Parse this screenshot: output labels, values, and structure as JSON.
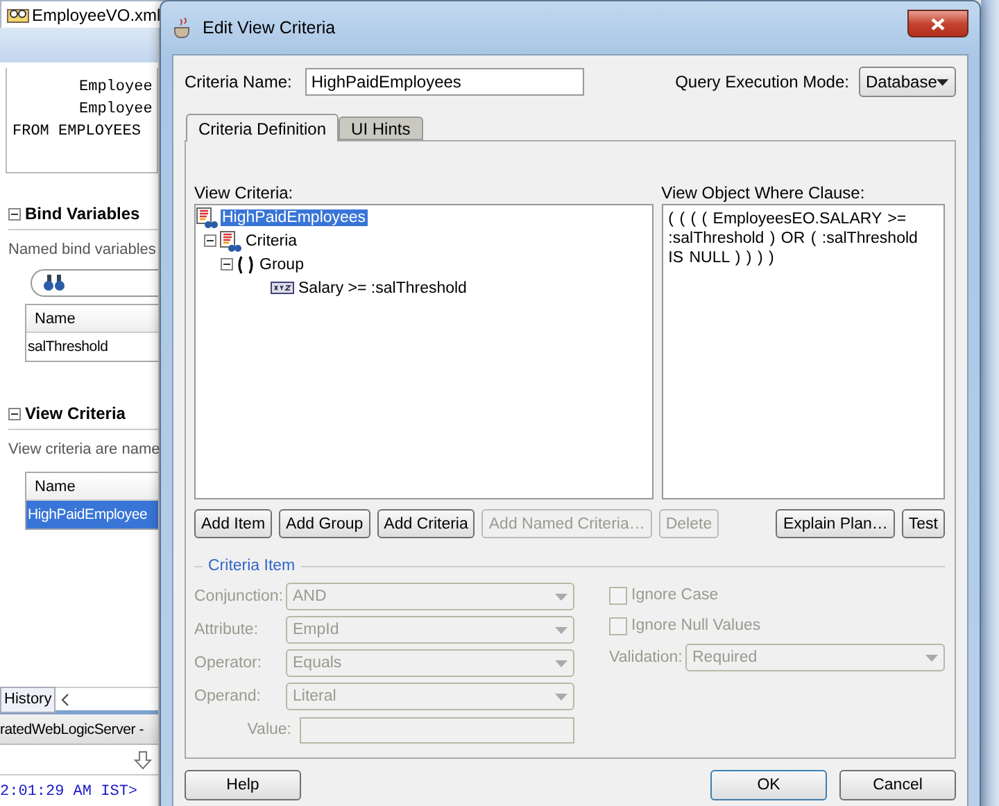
{
  "ide": {
    "editor_tab": "EmployeeVO.xml",
    "code_lines": [
      "Employee",
      "Employee",
      "FROM EMPLOYEES"
    ],
    "bind_variables": {
      "title": "Bind Variables",
      "expanded": true,
      "description": "Named bind variables",
      "columns": [
        "Name"
      ],
      "rows": [
        {
          "name": "salThreshold",
          "selected": false
        }
      ]
    },
    "view_criteria": {
      "title": "View Criteria",
      "expanded": true,
      "description": "View criteria are name",
      "columns": [
        "Name"
      ],
      "rows": [
        {
          "name": "HighPaidEmployee",
          "selected": true
        }
      ]
    },
    "bottom_tab": "History",
    "log": {
      "title": "ratedWebLogicServer -",
      "lines": [
        "2:01:29 AM IST>"
      ]
    }
  },
  "dialog": {
    "title": "Edit View Criteria",
    "criteria_name": {
      "label": "Criteria Name:",
      "value": "HighPaidEmployees"
    },
    "query_mode": {
      "label": "Query Execution Mode:",
      "value": "Database"
    },
    "tabs": [
      {
        "label": "Criteria Definition",
        "selected": true
      },
      {
        "label": "UI Hints",
        "selected": false
      }
    ],
    "view_criteria_label": "View Criteria:",
    "tree": [
      {
        "label": "HighPaidEmployees",
        "kind": "root",
        "selected": true,
        "children": [
          {
            "label": "Criteria",
            "kind": "criteria",
            "selected": false,
            "expanded": true,
            "children": [
              {
                "label": "Group",
                "kind": "group",
                "selected": false,
                "expanded": true,
                "children": [
                  {
                    "label": "Salary >= :salThreshold",
                    "kind": "item",
                    "selected": false
                  }
                ]
              }
            ]
          }
        ]
      }
    ],
    "where_clause": {
      "label": "View Object Where Clause:",
      "text": "( ( ( ( EmployeesEO.SALARY >= :salThreshold  ) OR  ( :salThreshold IS NULL ) ) ) )"
    },
    "tree_buttons": [
      {
        "label": "Add Item",
        "disabled": false
      },
      {
        "label": "Add Group",
        "disabled": false
      },
      {
        "label": "Add Criteria",
        "disabled": false
      },
      {
        "label": "Add Named Criteria…",
        "disabled": true
      },
      {
        "label": "Delete",
        "disabled": true
      }
    ],
    "query_buttons": [
      {
        "label": "Explain Plan…",
        "disabled": false
      },
      {
        "label": "Test",
        "disabled": false
      }
    ],
    "criteria_item": {
      "title": "Criteria Item",
      "fields": [
        {
          "label": "Conjunction:",
          "kind": "select",
          "value": "AND",
          "disabled": true
        },
        {
          "label": "Attribute:",
          "kind": "select",
          "value": "EmpId",
          "disabled": true
        },
        {
          "label": "Operator:",
          "kind": "select",
          "value": "Equals",
          "disabled": true
        },
        {
          "label": "Operand:",
          "kind": "select",
          "value": "Literal",
          "disabled": true
        },
        {
          "label": "Value:",
          "kind": "text",
          "disabled": true
        }
      ],
      "checkboxes": [
        {
          "label": "Ignore Case",
          "checked": false,
          "disabled": true
        },
        {
          "label": "Ignore Null Values",
          "checked": false,
          "disabled": true
        }
      ],
      "validation": {
        "label": "Validation:",
        "value": "Required",
        "disabled": true
      }
    },
    "footer_buttons": [
      {
        "label": "Help",
        "default": false
      },
      {
        "label": "OK",
        "default": true
      },
      {
        "label": "Cancel",
        "default": false
      }
    ]
  }
}
